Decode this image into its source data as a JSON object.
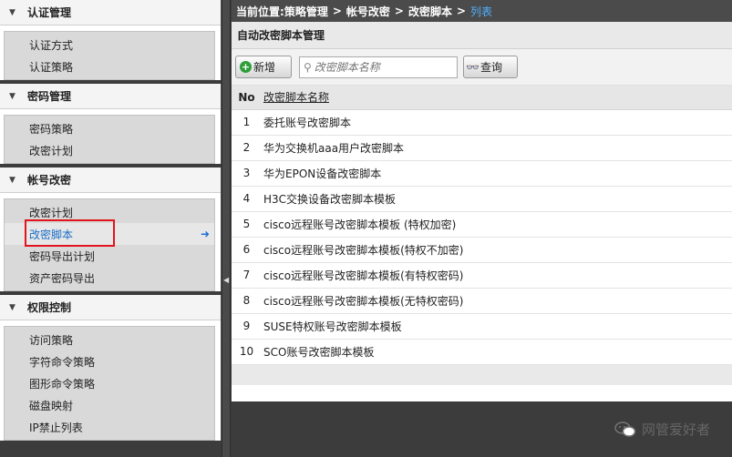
{
  "sidebar": {
    "groups": [
      {
        "title": "认证管理",
        "items": [
          "认证方式",
          "认证策略"
        ]
      },
      {
        "title": "密码管理",
        "items": [
          "密码策略",
          "改密计划"
        ]
      },
      {
        "title": "帐号改密",
        "items": [
          "改密计划",
          "改密脚本",
          "密码导出计划",
          "资产密码导出"
        ]
      },
      {
        "title": "权限控制",
        "items": [
          "访问策略",
          "字符命令策略",
          "图形命令策略",
          "磁盘映射",
          "IP禁止列表"
        ]
      }
    ]
  },
  "breadcrumb": {
    "prefix": "当前位置:",
    "path": [
      "策略管理",
      "帐号改密",
      "改密脚本"
    ],
    "current": "列表",
    "separator": ">"
  },
  "section_title": "自动改密脚本管理",
  "toolbar": {
    "add_label": "新增",
    "search_placeholder": "改密脚本名称",
    "query_label": "查询"
  },
  "table": {
    "headers": [
      "No",
      "改密脚本名称"
    ],
    "rows": [
      {
        "no": "1",
        "name": "委托账号改密脚本"
      },
      {
        "no": "2",
        "name": "华为交换机aaa用户改密脚本"
      },
      {
        "no": "3",
        "name": "华为EPON设备改密脚本"
      },
      {
        "no": "4",
        "name": "H3C交换设备改密脚本模板"
      },
      {
        "no": "5",
        "name": "cisco远程账号改密脚本模板 (特权加密)"
      },
      {
        "no": "6",
        "name": "cisco远程账号改密脚本模板(特权不加密)"
      },
      {
        "no": "7",
        "name": "cisco远程账号改密脚本模板(有特权密码)"
      },
      {
        "no": "8",
        "name": "cisco远程账号改密脚本模板(无特权密码)"
      },
      {
        "no": "9",
        "name": "SUSE特权账号改密脚本模板"
      },
      {
        "no": "10",
        "name": "SCO账号改密脚本模板"
      }
    ]
  },
  "watermark": "网管爱好者",
  "colors": {
    "accent": "#1a6fc9",
    "highlight_box": "#e2141b",
    "add_icon": "#2e9d3a"
  },
  "icons": {
    "group_toggle": "triangle-down-icon",
    "active_arrow": "arrow-right-icon",
    "add": "plus-circle-icon",
    "search": "search-icon",
    "query": "binoculars-icon",
    "splitter": "collapse-left-icon"
  }
}
